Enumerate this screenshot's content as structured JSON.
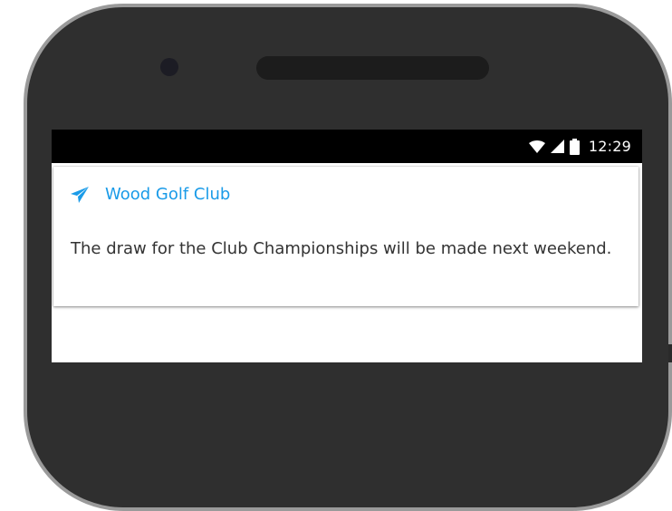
{
  "status_bar": {
    "time": "12:29",
    "icons": [
      "wifi-icon",
      "signal-icon",
      "battery-icon"
    ]
  },
  "notification": {
    "app_icon": "send-icon",
    "app_name": "Wood Golf Club",
    "message": "The draw for the Club Championships will be made next weekend."
  },
  "colors": {
    "accent": "#1a9be8",
    "text": "#333333",
    "status_bar": "#000000",
    "phone_body": "#2f2f2f",
    "phone_rim": "#9a9a9a"
  }
}
